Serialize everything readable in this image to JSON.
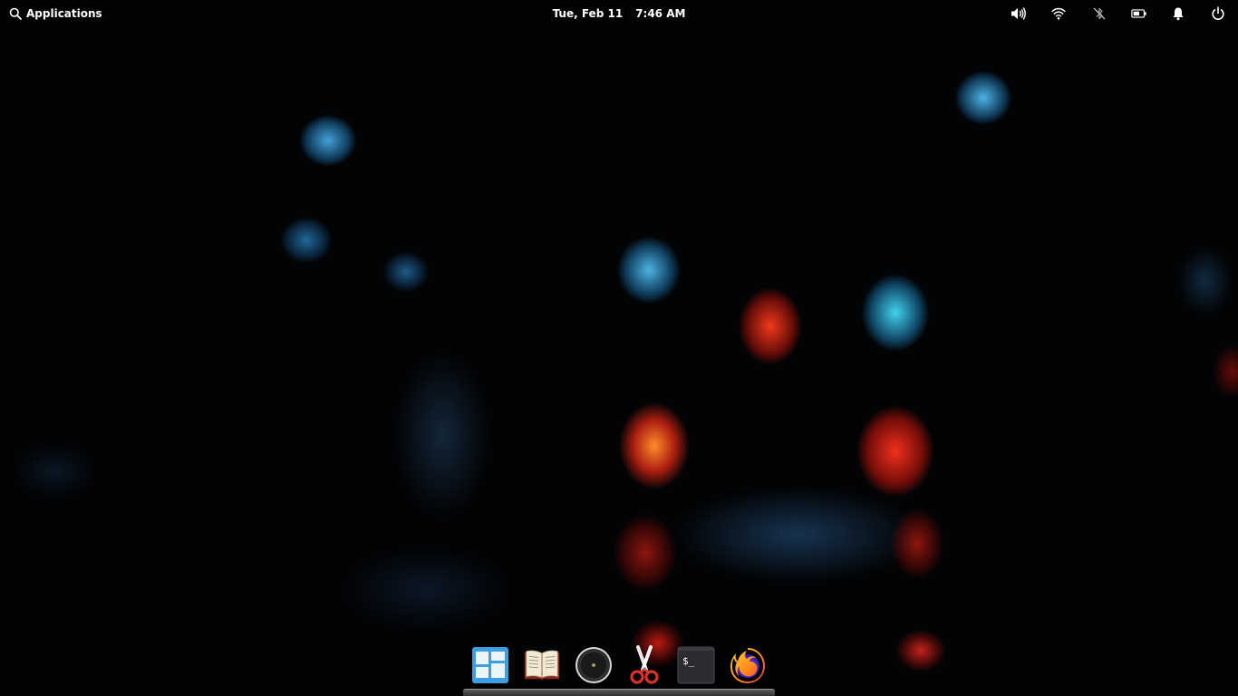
{
  "panel": {
    "applications_label": "Applications",
    "date": "Tue, Feb 11",
    "time": "7:46 AM",
    "indicators": [
      "volume-icon",
      "wifi-icon",
      "bluetooth-disabled-icon",
      "battery-icon",
      "notifications-icon",
      "power-icon"
    ]
  },
  "dock": {
    "items": [
      "multitasking-view-icon",
      "books-icon",
      "camera-icon",
      "screenshot-scissors-icon",
      "terminal-icon",
      "firefox-icon"
    ],
    "terminal_prompt": "$_"
  },
  "colors": {
    "panel_text": "#ffffff",
    "multitasking_blue": "#3d9ee0",
    "firefox_orange": "#ff8a1a",
    "firefox_purple": "#6b2fd1",
    "scissors_red": "#d9322b"
  }
}
